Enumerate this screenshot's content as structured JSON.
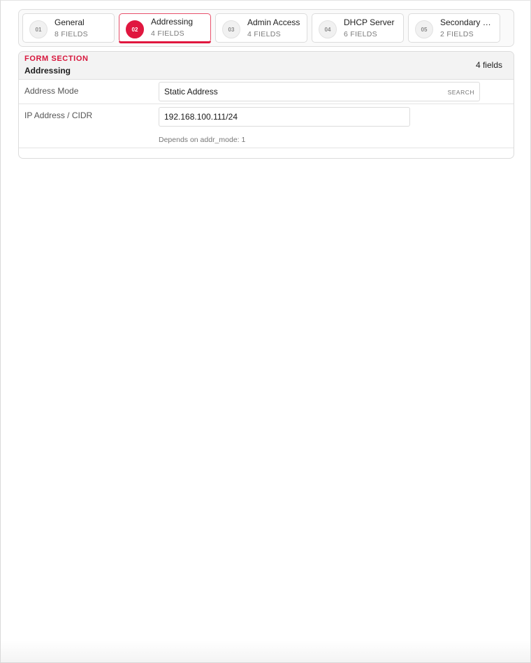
{
  "tabs": [
    {
      "num": "01",
      "title": "General",
      "count": "8 FIELDS"
    },
    {
      "num": "02",
      "title": "Addressing",
      "count": "4 FIELDS"
    },
    {
      "num": "03",
      "title": "Admin Access",
      "count": "4 FIELDS"
    },
    {
      "num": "04",
      "title": "DHCP Server",
      "count": "6 FIELDS"
    },
    {
      "num": "05",
      "title": "Secondary …",
      "count": "2 FIELDS"
    }
  ],
  "section": {
    "kicker": "FORM SECTION",
    "title": "Addressing",
    "field_count": "4 fields",
    "fields": {
      "address_mode": {
        "label": "Address Mode",
        "value": "Static Address",
        "search_tag": "SEARCH"
      },
      "ip_cidr": {
        "label": "IP Address / CIDR",
        "value": "192.168.100.111/24",
        "hint": "Depends on addr_mode: 1"
      }
    }
  },
  "colors": {
    "accent": "#e0173f",
    "kicker": "#d7163c"
  }
}
